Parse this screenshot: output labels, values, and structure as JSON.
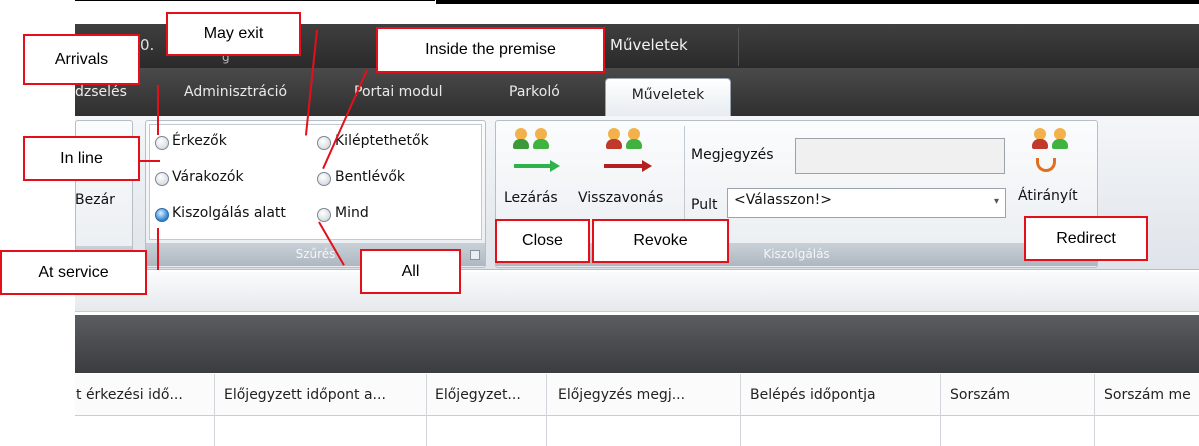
{
  "window": {
    "title_fragment": "0.",
    "title_fragment2": "g",
    "context_tab": "Műveletek"
  },
  "tabs": [
    {
      "label": "dzselés"
    },
    {
      "label": "Adminisztráció"
    },
    {
      "label": "Portai modul"
    },
    {
      "label": "Parkoló"
    },
    {
      "label": "Műveletek",
      "active": true
    }
  ],
  "ribbon": {
    "left_group": {
      "button_label": "Bezár"
    },
    "filter": {
      "footer": "Szűrés",
      "options": [
        {
          "label": "Érkezők",
          "selected": false
        },
        {
          "label": "Kiléptethetők",
          "selected": false
        },
        {
          "label": "Várakozók",
          "selected": false
        },
        {
          "label": "Bentlévők",
          "selected": false
        },
        {
          "label": "Kiszolgálás alatt",
          "selected": true
        },
        {
          "label": "Mind",
          "selected": false
        }
      ]
    },
    "service": {
      "footer": "Kiszolgálás",
      "close_label": "Lezárás",
      "revoke_label": "Visszavonás",
      "note_label": "Megjegyzés",
      "note_value": "",
      "desk_label": "Pult",
      "desk_value": "<Válasszon!>",
      "redirect_label": "Átirányít"
    }
  },
  "grid": {
    "columns": [
      "t érkezési idő...",
      "Előjegyzett időpont a...",
      "Előjegyzet...",
      "Előjegyzés megj...",
      "Belépés időpontja",
      "Sorszám",
      "Sorszám me"
    ]
  },
  "annotations": {
    "arrivals": "Arrivals",
    "may_exit": "May exit",
    "inside": "Inside the premise",
    "in_line": "In line",
    "at_service": "At service",
    "all": "All",
    "close": "Close",
    "revoke": "Revoke",
    "redirect": "Redirect"
  },
  "colors": {
    "callout_border": "#e3101a",
    "titlebar": "#2f2f2f",
    "ribbon_footer": "#aeb7c1",
    "selected_radio": "#3c8fd8"
  }
}
